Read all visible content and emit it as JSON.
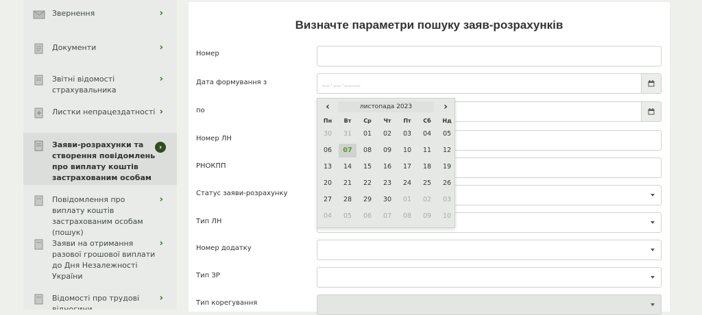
{
  "sidebar": {
    "items": [
      {
        "label": "Звернення",
        "icon": "envelope-icon"
      },
      {
        "label": "Документи",
        "icon": "documents-icon"
      },
      {
        "label": "Звітні відомості страхувальника",
        "icon": "report-icon"
      },
      {
        "label": "Листки непрацездатності",
        "icon": "sick-leave-icon"
      },
      {
        "label": "Заяви-розрахунки та створення повідомлень про виплату коштів застрахованим особам",
        "icon": "application-icon"
      },
      {
        "label": "Повідомлення про виплату коштів застрахованим особам (пошук)",
        "icon": "notification-icon"
      },
      {
        "label": "Заяви на отримання разової грошової виплати до Дня Незалежності України",
        "icon": "payment-application-icon"
      },
      {
        "label": "Відомості про трудові відносини",
        "icon": "labor-relations-icon"
      }
    ],
    "chevron": "›",
    "active_marker": "›"
  },
  "form": {
    "title": "Визначте параметри пошуку заяв-розрахунків",
    "labels": {
      "number": "Номер",
      "date_from": "Дата формування з",
      "date_to": "по",
      "ln_number": "Номер ЛН",
      "rnokpp": "РНОКПП",
      "status": "Статус заяви-розрахунку",
      "ln_type": "Тип ЛН",
      "appendix_number": "Номер додатку",
      "zr_type": "Тип ЗР",
      "correction_type": "Тип корегування"
    },
    "date_from_placeholder": "__.__.____"
  },
  "calendar": {
    "month_title": "листопада 2023",
    "prev": "‹",
    "next": "›",
    "weekdays": [
      "Пн",
      "Вт",
      "Ср",
      "Чт",
      "Пт",
      "Сб",
      "Нд"
    ],
    "weeks": [
      [
        "30",
        "31",
        "01",
        "02",
        "03",
        "04",
        "05"
      ],
      [
        "06",
        "07",
        "08",
        "09",
        "10",
        "11",
        "12"
      ],
      [
        "13",
        "14",
        "15",
        "16",
        "17",
        "18",
        "19"
      ],
      [
        "20",
        "21",
        "22",
        "23",
        "24",
        "25",
        "26"
      ],
      [
        "27",
        "28",
        "29",
        "30",
        "01",
        "02",
        "03"
      ],
      [
        "04",
        "05",
        "06",
        "07",
        "08",
        "09",
        "10"
      ]
    ],
    "today": "07"
  },
  "colors": {
    "accent_green": "#2f6b23",
    "today_green": "#4a9a2a"
  }
}
